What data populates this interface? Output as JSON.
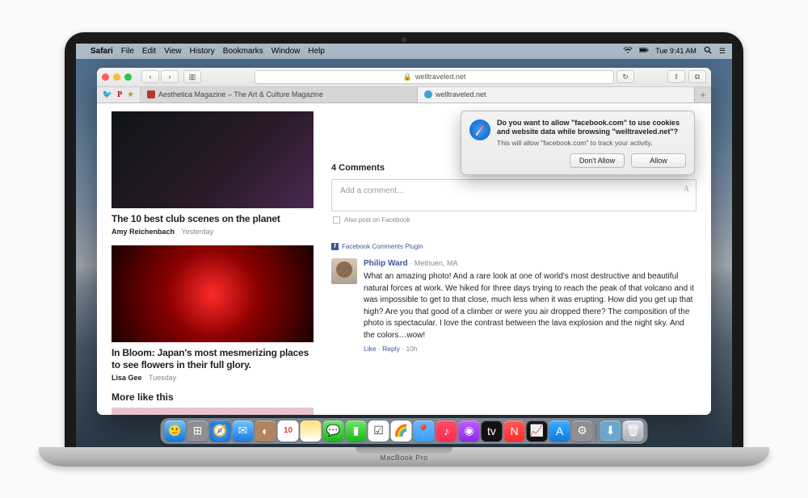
{
  "hardware": {
    "label": "MacBook Pro"
  },
  "menubar": {
    "app_name": "Safari",
    "items": [
      "File",
      "Edit",
      "View",
      "History",
      "Bookmarks",
      "Window",
      "Help"
    ],
    "clock": "Tue 9:41 AM"
  },
  "dock_colors": [
    "#e8e8f0",
    "#2a9df4",
    "#2a9df4",
    "#e53b3b",
    "#8a5cff",
    "#3ac24a",
    "#2ecc71",
    "#2a9df4",
    "#666",
    "#fff",
    "#ff9500",
    "#ff3b30",
    "#ff2d55",
    "#a259ff",
    "#1db954",
    "#333",
    "#34c759",
    "#5856d6",
    "#0a84ff",
    "#147efb",
    "#8e8e93",
    "#8e8e93"
  ],
  "safari": {
    "address": "welltraveled.net",
    "tabs": [
      {
        "label": "Aesthetica Magazine – The Art & Culture Magazine",
        "active": false,
        "favicon": "#b1392a"
      },
      {
        "label": "welltraveled.net",
        "active": true,
        "favicon": "#3aa3d8"
      }
    ],
    "bookmark_icons": [
      {
        "name": "twitter-icon",
        "glyph": "🐦",
        "color": "#1da1f2"
      },
      {
        "name": "pinterest-icon",
        "glyph": "P",
        "color": "#bd081c"
      },
      {
        "name": "bookmark-icon",
        "glyph": "★",
        "color": "#d09030"
      }
    ]
  },
  "page": {
    "articles": [
      {
        "title": "The 10 best club scenes on the planet",
        "author": "Amy Reichenbach",
        "date": "Yesterday"
      },
      {
        "title": "In Bloom: Japan's most mesmerizing places to see flowers in their full glory.",
        "author": "Lisa Gee",
        "date": "Tuesday"
      }
    ],
    "more_like_this": "More like this",
    "comments_heading": "4 Comments",
    "comment_placeholder": "Add a comment...",
    "also_post": "Also post on Facebook",
    "fb_plugin": "Facebook Comments Plugin",
    "comment": {
      "name": "Philip Ward",
      "location": "Methuen, MA",
      "body": "What an amazing photo! And a rare look at one of world's most destructive and beautiful natural forces at work. We hiked for three days trying to reach the peak of that volcano and it was impossible to get to that close, much less when it was erupting. How did you get up that high? Are you that good of a climber or were you air dropped there? The composition of the photo is spectacular. I love the contrast between the lava explosion and the night sky. And the colors…wow!",
      "like": "Like",
      "reply": "Reply",
      "time": "10h"
    }
  },
  "popover": {
    "question": "Do you want to allow \"facebook.com\" to use cookies and website data while browsing \"welltraveled.net\"?",
    "subtext": "This will allow \"facebook.com\" to track your activity.",
    "dont_allow": "Don't Allow",
    "allow": "Allow"
  }
}
